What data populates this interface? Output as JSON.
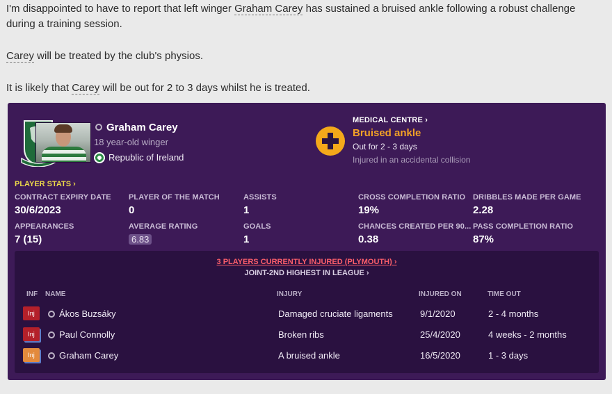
{
  "message": {
    "p1_before": "I'm disappointed to have to report that left winger ",
    "p1_link": "Graham Carey",
    "p1_after": " has sustained a bruised ankle following a robust challenge during a training session.",
    "p2_link": "Carey",
    "p2_after": " will be treated by the club's physios.",
    "p3_before": "It is likely that ",
    "p3_link": "Carey",
    "p3_after": " will be out for 2 to 3 days whilst he is treated."
  },
  "player": {
    "name": "Graham Carey",
    "description": "18 year-old winger",
    "nationality": "Republic of Ireland"
  },
  "medical": {
    "title": "MEDICAL CENTRE",
    "injury": "Bruised ankle",
    "out_for": "Out for 2 - 3 days",
    "cause": "Injured in an accidental collision"
  },
  "stats": {
    "title": "PLAYER STATS",
    "items": [
      {
        "label": "CONTRACT EXPIRY DATE",
        "value": "30/6/2023"
      },
      {
        "label": "PLAYER OF THE MATCH",
        "value": "0"
      },
      {
        "label": "ASSISTS",
        "value": "1"
      },
      {
        "label": "CROSS COMPLETION RATIO",
        "value": "19%"
      },
      {
        "label": "DRIBBLES MADE PER GAME",
        "value": "2.28"
      },
      {
        "label": "APPEARANCES",
        "value": "7 (15)"
      },
      {
        "label": "AVERAGE RATING",
        "value": "6.83"
      },
      {
        "label": "GOALS",
        "value": "1"
      },
      {
        "label": "CHANCES CREATED PER 90...",
        "value": "0.38"
      },
      {
        "label": "PASS COMPLETION RATIO",
        "value": "87%"
      }
    ]
  },
  "injuries": {
    "headline": "3 PLAYERS CURRENTLY INJURED (PLYMOUTH)",
    "sub": "JOINT-2ND HIGHEST IN LEAGUE",
    "columns": {
      "inf": "INF",
      "name": "NAME",
      "injury": "INJURY",
      "injured_on": "INJURED ON",
      "time_out": "TIME OUT"
    },
    "rows": [
      {
        "badge": "Inj",
        "name": "Ákos Buzsáky",
        "injury": "Damaged cruciate ligaments",
        "injured_on": "9/1/2020",
        "time_out": "2 - 4 months"
      },
      {
        "badge": "Inj",
        "name": "Paul Connolly",
        "injury": "Broken ribs",
        "injured_on": "25/4/2020",
        "time_out": "4 weeks - 2 months"
      },
      {
        "badge": "Inj",
        "name": "Graham Carey",
        "injury": "A bruised ankle",
        "injured_on": "16/5/2020",
        "time_out": "1 - 3 days"
      }
    ]
  },
  "colors": {
    "card_bg": "#3d1a57",
    "accent_orange": "#f4a91a",
    "stats_title": "#ecd84a",
    "injury_link": "#ff5f6b"
  }
}
